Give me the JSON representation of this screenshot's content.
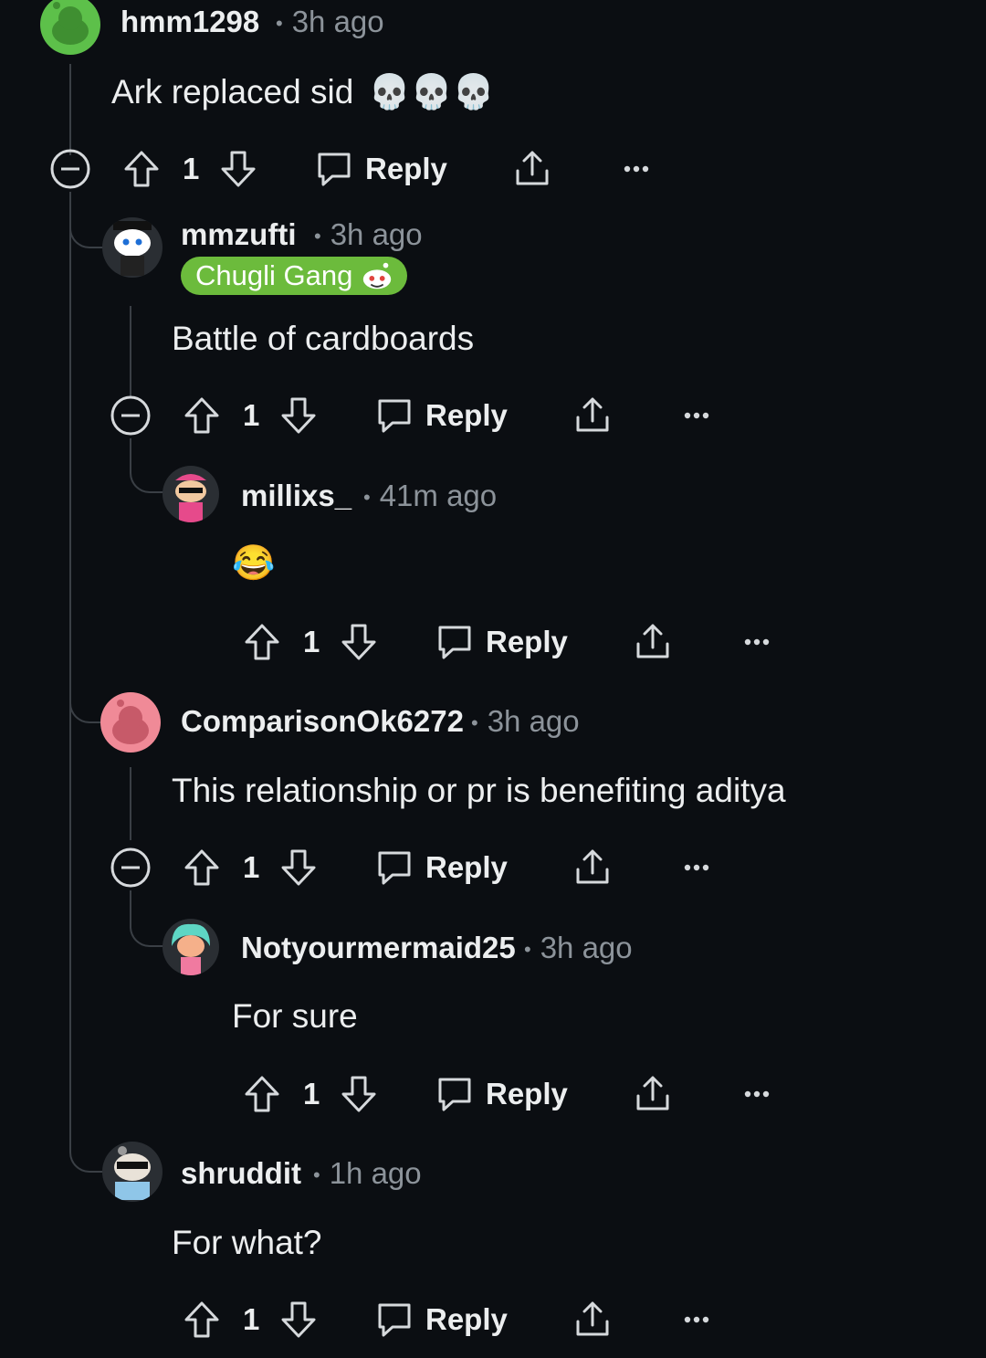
{
  "comments": [
    {
      "username": "hmm1298",
      "time": "3h ago",
      "text": "Ark replaced sid",
      "emoji": "💀💀💀",
      "votes": "1",
      "reply_label": "Reply"
    },
    {
      "username": "mmzufti",
      "time": "3h ago",
      "flair": "Chugli Gang",
      "text": "Battle of cardboards",
      "votes": "1",
      "reply_label": "Reply"
    },
    {
      "username": "millixs_",
      "time": "41m ago",
      "text": "😂",
      "votes": "1",
      "reply_label": "Reply"
    },
    {
      "username": "ComparisonOk6272",
      "time": "3h ago",
      "text": "This relationship or pr is benefiting aditya",
      "votes": "1",
      "reply_label": "Reply"
    },
    {
      "username": "Notyourmermaid25",
      "time": "3h ago",
      "text": "For sure",
      "votes": "1",
      "reply_label": "Reply"
    },
    {
      "username": "shruddit",
      "time": "1h ago",
      "text": "For what?",
      "votes": "1",
      "reply_label": "Reply"
    }
  ],
  "meta_separator": "•",
  "colors": {
    "background": "#0b0e12",
    "text": "#eceeef",
    "muted": "#8c939a",
    "thread_line": "#3a3f45",
    "flair_bg": "#6cbb3c"
  },
  "icons": {
    "collapse": "collapse-minus-icon",
    "upvote": "upvote-arrow-icon",
    "downvote": "downvote-arrow-icon",
    "reply": "reply-bubble-icon",
    "share": "share-icon",
    "more": "more-dots-icon"
  }
}
